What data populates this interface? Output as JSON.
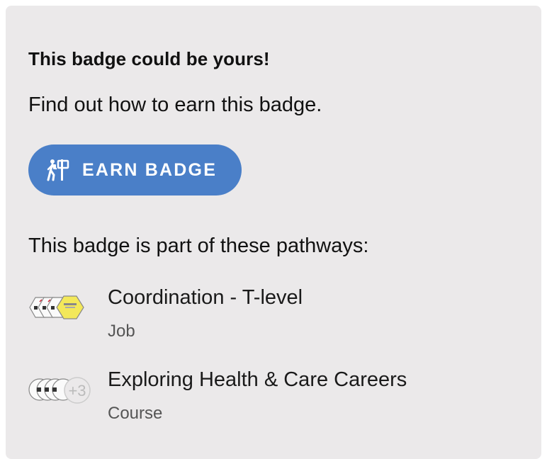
{
  "card": {
    "headline": "This badge could be yours!",
    "subline": "Find out how to earn this badge.",
    "earn_button": {
      "label": "EARN BADGE",
      "icon": "hiker-signpost-icon",
      "color": "#4a7fc8"
    },
    "pathways_title": "This badge is part of these pathways:",
    "pathways": [
      {
        "name": "Coordination - T-level",
        "type": "Job",
        "badge_stack": "badge-stack-icon"
      },
      {
        "name": "Exploring Health & Care Careers",
        "type": "Course",
        "badge_stack": "badge-stack-icon",
        "more_count": "+3"
      }
    ]
  }
}
